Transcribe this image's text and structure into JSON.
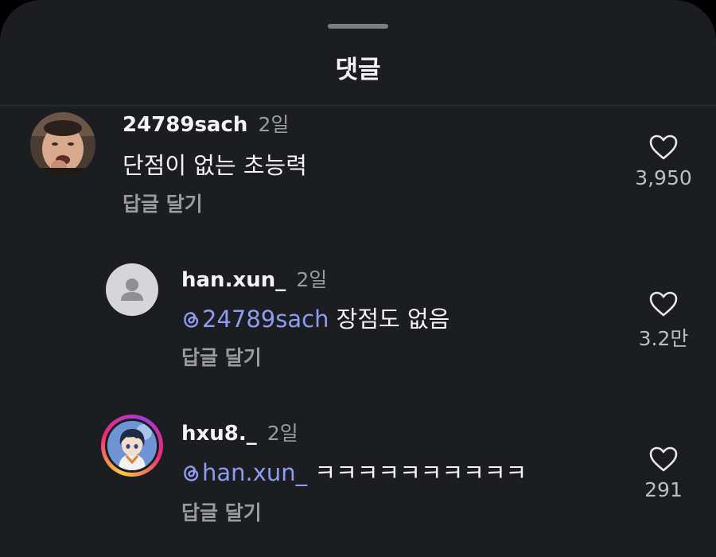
{
  "sheet": {
    "title": "댓글"
  },
  "comments": [
    {
      "username": "24789sach",
      "time": "2일",
      "text": "단점이 없는 초능력",
      "reply_label": "답글 달기",
      "like_count": "3,950"
    },
    {
      "username": "han.xun_",
      "time": "2일",
      "mention": "24789sach",
      "text": " 장점도 없음",
      "reply_label": "답글 달기",
      "like_count": "3.2만"
    },
    {
      "username": "hxu8._",
      "time": "2일",
      "mention": "han.xun_",
      "text": " ㅋㅋㅋㅋㅋㅋㅋㅋㅋㅋ",
      "reply_label": "답글 달기",
      "like_count": "291"
    }
  ],
  "icons": {
    "grabber": "drag-handle",
    "like": "heart-outline-icon",
    "mention": "threads-mention-icon"
  },
  "colors": {
    "background": "#1c1d21",
    "mention": "#8e9bf2",
    "muted": "#9a9ba0"
  }
}
